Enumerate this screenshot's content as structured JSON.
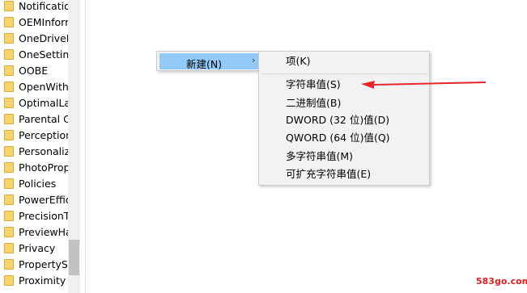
{
  "tree": {
    "items": [
      "Notification",
      "OEMInforr",
      "OneDriveF",
      "OneSetting",
      "OOBE",
      "OpenWith",
      "OptimalLa",
      "Parental C",
      "Perception",
      "Personaliz",
      "PhotoProp",
      "Policies",
      "PowerEffic",
      "PrecisionT",
      "PreviewHa",
      "Privacy",
      "PropertySy",
      "Proximity"
    ]
  },
  "context_menu": {
    "parent_label": "新建(N)",
    "parent_arrow": "›",
    "submenu": [
      "项(K)",
      "字符串值(S)",
      "二进制值(B)",
      "DWORD (32 位)值(D)",
      "QWORD (64 位)值(Q)",
      "多字符串值(M)",
      "可扩充字符串值(E)"
    ]
  },
  "colors": {
    "highlight": "#91c9f7",
    "folder": "#f6d36c",
    "arrow": "#e8242c"
  },
  "icons": {
    "folder": "folder-icon",
    "submenu_arrow": "chevron-right-icon"
  },
  "watermark": "583go.com"
}
